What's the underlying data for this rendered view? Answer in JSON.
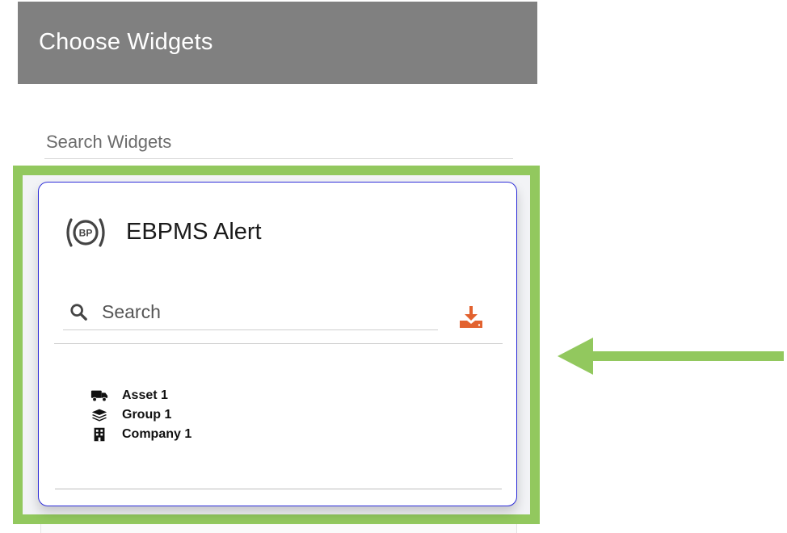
{
  "header": {
    "title": "Choose Widgets"
  },
  "widget_search": {
    "placeholder": "Search Widgets"
  },
  "widget_card": {
    "icon": "brake-pad-bp-icon",
    "title": "EBPMS Alert",
    "search": {
      "icon": "search-icon",
      "placeholder": "Search"
    },
    "download_icon": "download-icon",
    "accent_color": "#e2622f",
    "targets": [
      {
        "icon": "truck-icon",
        "label": "Asset 1"
      },
      {
        "icon": "layers-icon",
        "label": "Group 1"
      },
      {
        "icon": "building-icon",
        "label": "Company 1"
      }
    ]
  },
  "annotation": {
    "highlight_color": "#92c85e",
    "arrow_icon": "left-arrow-icon"
  }
}
